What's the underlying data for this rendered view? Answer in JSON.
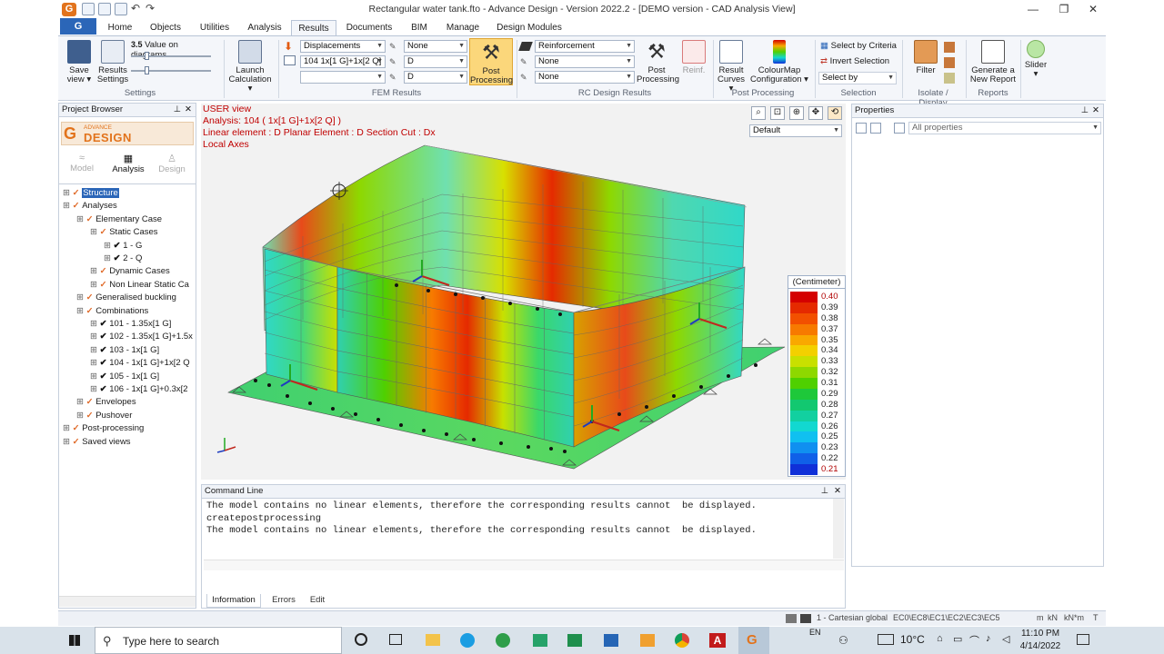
{
  "window": {
    "title": "Rectangular water tank.fto - Advance Design - Version 2022.2 - [DEMO version - CAD Analysis View]",
    "app_button": "G"
  },
  "menu_tabs": [
    "Home",
    "Objects",
    "Utilities",
    "Analysis",
    "Results",
    "Documents",
    "BIM",
    "Manage",
    "Design Modules"
  ],
  "active_tab": "Results",
  "ribbon": {
    "settings": {
      "save_view": "Save view",
      "results_settings": "Results Settings",
      "value_on_diagrams": "Value on diagrams",
      "group": "Settings"
    },
    "launch_calculation": "Launch Calculation",
    "fem": {
      "result_type": "Displacements",
      "combination": "104 1x[1 G]+1x[2 Q]",
      "sub1": "None",
      "sub2": "D",
      "sub3": "D",
      "post_processing": "Post Processing",
      "group": "FEM Results"
    },
    "rc": {
      "reinforcement": "Reinforcement",
      "none1": "None",
      "none2": "None",
      "post_processing": "Post Processing",
      "reinf": "Reinf.",
      "group": "RC Design Results"
    },
    "post": {
      "result_curves": "Result Curves",
      "colourmap": "ColourMap Configuration",
      "group": "Post Processing"
    },
    "selection": {
      "by_criteria": "Select by Criteria",
      "invert": "Invert Selection",
      "select_by": "Select by",
      "group": "Selection"
    },
    "isolate": {
      "filter": "Filter",
      "group": "Isolate / Display"
    },
    "reports": {
      "generate": "Generate a New Report",
      "group": "Reports"
    },
    "slider": "Slider"
  },
  "project_browser": {
    "title": "Project Browser",
    "brand_small": "ADVANCE",
    "brand": "DESIGN",
    "modes": [
      "Model",
      "Analysis",
      "Design"
    ],
    "tree": [
      {
        "label": "Structure",
        "indent": 0,
        "selected": true
      },
      {
        "label": "Analyses",
        "indent": 0
      },
      {
        "label": "Elementary Case",
        "indent": 1
      },
      {
        "label": "Static Cases",
        "indent": 2
      },
      {
        "label": "1 - G",
        "indent": 3
      },
      {
        "label": "2 - Q",
        "indent": 3
      },
      {
        "label": "Dynamic Cases",
        "indent": 2
      },
      {
        "label": "Non Linear Static Ca",
        "indent": 2
      },
      {
        "label": "Generalised buckling",
        "indent": 1
      },
      {
        "label": "Combinations",
        "indent": 1
      },
      {
        "label": "101 - 1.35x[1 G]",
        "indent": 2
      },
      {
        "label": "102 - 1.35x[1 G]+1.5x",
        "indent": 2
      },
      {
        "label": "103 - 1x[1 G]",
        "indent": 2
      },
      {
        "label": "104 - 1x[1 G]+1x[2 Q",
        "indent": 2
      },
      {
        "label": "105 - 1x[1 G]",
        "indent": 2
      },
      {
        "label": "106 - 1x[1 G]+0.3x[2",
        "indent": 2
      },
      {
        "label": "Envelopes",
        "indent": 1
      },
      {
        "label": "Pushover",
        "indent": 1
      },
      {
        "label": "Post-processing",
        "indent": 0
      },
      {
        "label": "Saved views",
        "indent": 0
      }
    ]
  },
  "viewport": {
    "line1": "USER view",
    "line2": "Analysis: 104  ( 1x[1 G]+1x[2 Q] )",
    "line3": "Linear element : D Planar Element : D Section Cut : Dx",
    "line4": "Local Axes",
    "view_combo": "Default"
  },
  "legend": {
    "unit": "(Centimeter)",
    "entries": [
      {
        "value": "0.40",
        "color": "#d40000"
      },
      {
        "value": "0.39",
        "color": "#e52a00"
      },
      {
        "value": "0.38",
        "color": "#f25000"
      },
      {
        "value": "0.37",
        "color": "#f77a00"
      },
      {
        "value": "0.35",
        "color": "#f9a800"
      },
      {
        "value": "0.34",
        "color": "#f3d000"
      },
      {
        "value": "0.33",
        "color": "#c8e000"
      },
      {
        "value": "0.32",
        "color": "#8ed800"
      },
      {
        "value": "0.31",
        "color": "#4fd000"
      },
      {
        "value": "0.29",
        "color": "#1ec83a"
      },
      {
        "value": "0.28",
        "color": "#12c870"
      },
      {
        "value": "0.27",
        "color": "#12d0a0"
      },
      {
        "value": "0.26",
        "color": "#12d8d0"
      },
      {
        "value": "0.25",
        "color": "#10c0f0"
      },
      {
        "value": "0.23",
        "color": "#1090f0"
      },
      {
        "value": "0.22",
        "color": "#1060e8"
      },
      {
        "value": "0.21",
        "color": "#1030d8"
      }
    ]
  },
  "command_line": {
    "title": "Command Line",
    "lines": [
      "The model contains no linear elements, therefore the corresponding results cannot  be displayed.",
      "createpostprocessing",
      "The model contains no linear elements, therefore the corresponding results cannot  be displayed."
    ],
    "tabs": [
      "Information",
      "Errors",
      "Edit"
    ]
  },
  "properties": {
    "title": "Properties",
    "filter": "All properties"
  },
  "status": {
    "coord": "1 - Cartesian global",
    "codes": "EC0\\EC8\\EC1\\EC2\\EC3\\EC5",
    "units": [
      "m",
      "kN",
      "kN*m",
      "T"
    ]
  },
  "taskbar": {
    "search": "Type here to search",
    "temp": "10°C",
    "lang": "EN",
    "time": "11:10 PM",
    "date": "4/14/2022"
  }
}
